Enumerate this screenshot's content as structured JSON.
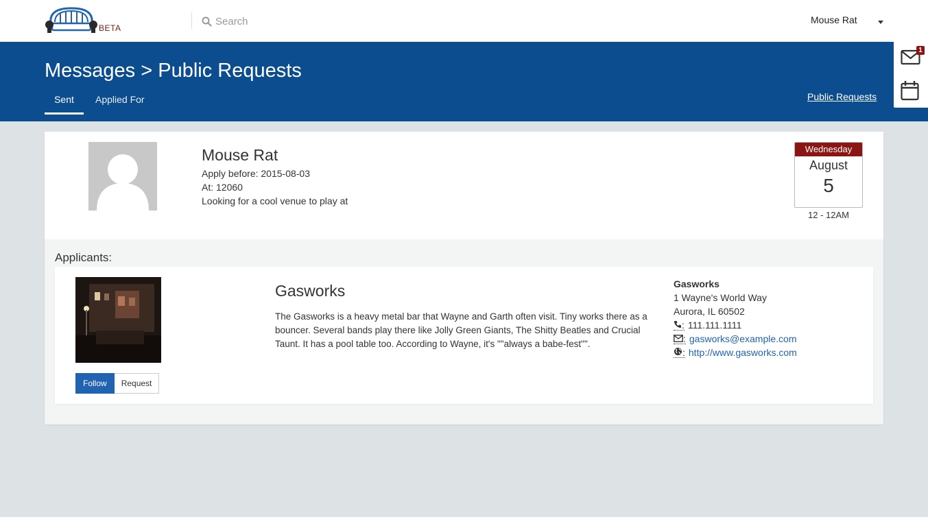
{
  "nav": {
    "logo_badge": "BETA",
    "search_placeholder": "Search",
    "user_name": "Mouse Rat"
  },
  "header": {
    "title": "Messages > Public Requests",
    "tabs": [
      {
        "label": "Sent",
        "active": true
      },
      {
        "label": "Applied For",
        "active": false
      }
    ],
    "link": "Public Requests"
  },
  "side_panel": {
    "mail_badge": "1"
  },
  "request": {
    "name": "Mouse Rat",
    "apply_before": "Apply before: 2015-08-03",
    "at": "At: 12060",
    "description": "Looking for a cool venue to play at",
    "calendar": {
      "weekday": "Wednesday",
      "month": "August",
      "day": "5",
      "time": "12 - 12AM"
    }
  },
  "applicants_label": "Applicants:",
  "applicants": [
    {
      "name": "Gasworks",
      "description": "The Gasworks is a heavy metal bar that Wayne and Garth often visit. Tiny works there as a bouncer. Several bands play there like Jolly Green Giants, The Shitty Beatles and Crucial Taunt. It has a pool table too. According to Wayne, it's \"\"always a babe-fest\"\".",
      "follow_label": "Follow",
      "request_label": "Request",
      "contact": {
        "name": "Gasworks",
        "address1": "1 Wayne's World Way",
        "address2": "Aurora, IL 60502",
        "phone": "111.111.1111",
        "email": "gasworks@example.com",
        "website": "http://www.gasworks.com"
      }
    }
  ],
  "colors": {
    "header_blue": "#0b4d8f",
    "accent_red": "#8b1513",
    "button_blue": "#1f63b1",
    "page_bg": "#dde2e5"
  }
}
